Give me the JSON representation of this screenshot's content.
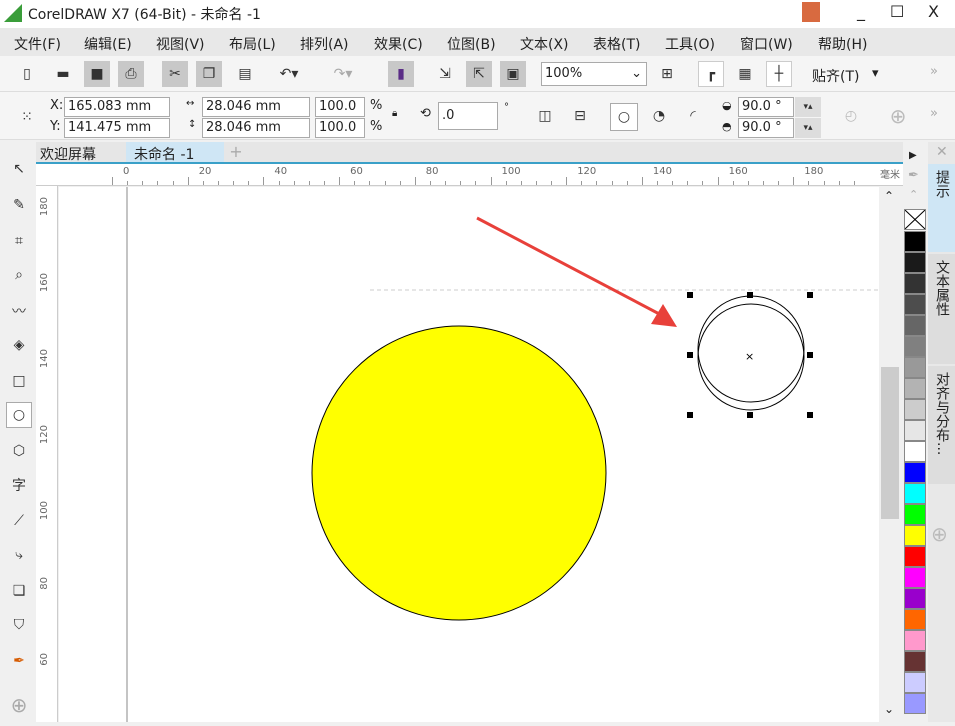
{
  "window": {
    "title": "CorelDRAW X7 (64-Bit) - 未命名 -1",
    "controls": [
      "_",
      "☐",
      "X"
    ]
  },
  "menu": [
    "文件(F)",
    "编辑(E)",
    "视图(V)",
    "布局(L)",
    "排列(A)",
    "效果(C)",
    "位图(B)",
    "文本(X)",
    "表格(T)",
    "工具(O)",
    "窗口(W)",
    "帮助(H)"
  ],
  "toolbar": {
    "zoom": "100%",
    "snap": "贴齐(T)"
  },
  "props": {
    "x_label": "X:",
    "x": "165.083 mm",
    "y_label": "Y:",
    "y": "141.475 mm",
    "w": "28.046 mm",
    "h": "28.046 mm",
    "sx": "100.0",
    "sy": "100.0",
    "pct": "%",
    "rotation": ".0",
    "deg": "°",
    "start_angle": "90.0 °",
    "end_angle": "90.0 °"
  },
  "tabs": [
    "欢迎屏幕",
    "未命名 -1"
  ],
  "ruler": {
    "unit": "毫米",
    "h_ticks": [
      "0",
      "20",
      "40",
      "60",
      "80",
      "100",
      "120",
      "140",
      "160",
      "180"
    ],
    "v_ticks": [
      "180",
      "160",
      "140",
      "120",
      "100",
      "80",
      "60"
    ]
  },
  "dock": [
    "提示",
    "文本属性",
    "对齐与分布..."
  ],
  "colors": {
    "fill": "#ffff00",
    "arrow": "#e8403a",
    "accent": "#3aa0c8"
  },
  "palette": [
    "#000000",
    "#1a1a1a",
    "#333333",
    "#4d4d4d",
    "#666666",
    "#808080",
    "#999999",
    "#b3b3b3",
    "#cccccc",
    "#e6e6e6",
    "#ffffff",
    "#0000ff",
    "#00ffff",
    "#00ff00",
    "#ffff00",
    "#ff0000",
    "#ff00ff",
    "#9900cc",
    "#ff6600",
    "#ff99cc",
    "#663333",
    "#ccccff",
    "#9999ff"
  ]
}
